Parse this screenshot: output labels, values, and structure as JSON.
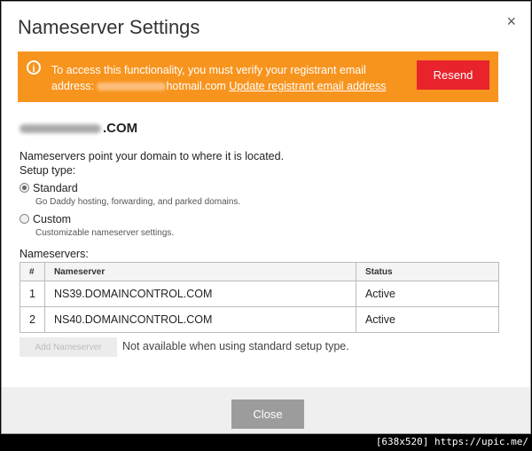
{
  "dialog": {
    "title": "Nameserver Settings",
    "close_glyph": "×"
  },
  "banner": {
    "icon": "info-icon",
    "icon_glyph": "i",
    "line1": "To access this functionality, you must verify your registrant email",
    "line2_prefix": "address:",
    "email_suffix": "hotmail.com",
    "link": "Update registrant email address",
    "resend_label": "Resend",
    "bg_color": "#f7941e",
    "button_color": "#e8232c"
  },
  "domain": {
    "suffix": ".COM"
  },
  "description": "Nameservers point your domain to where it is located.",
  "setup_type": {
    "label": "Setup type:",
    "options": [
      {
        "label": "Standard",
        "sub": "Go Daddy hosting, forwarding, and parked domains.",
        "selected": true
      },
      {
        "label": "Custom",
        "sub": "Customizable nameserver settings.",
        "selected": false
      }
    ]
  },
  "nameservers": {
    "label": "Nameservers:",
    "headers": [
      "#",
      "Nameserver",
      "Status"
    ],
    "rows": [
      {
        "num": "1",
        "name": "NS39.DOMAINCONTROL.COM",
        "status": "Active"
      },
      {
        "num": "2",
        "name": "NS40.DOMAINCONTROL.COM",
        "status": "Active"
      }
    ],
    "add_button": "Add Nameserver",
    "add_note": "Not available when using standard setup type."
  },
  "footer": {
    "close_label": "Close"
  },
  "watermark": "[638x520] https://upic.me/"
}
